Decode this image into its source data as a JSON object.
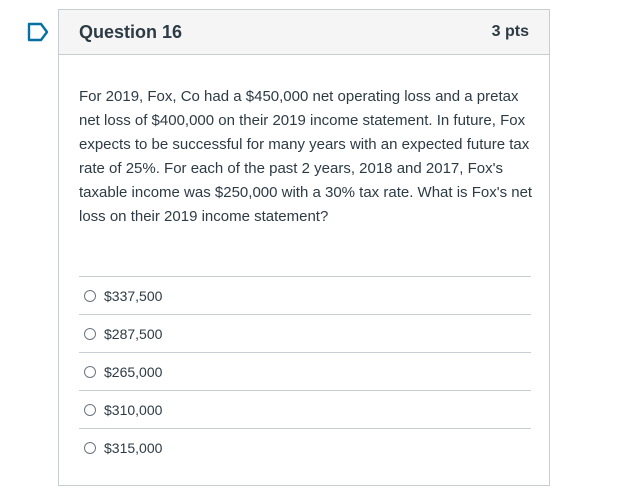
{
  "icons": {
    "flag": "flag-outline-icon",
    "flag_color": "#0770a3",
    "radio": "radio-unselected-icon"
  },
  "question": {
    "title": "Question 16",
    "points": "3 pts",
    "text": "For 2019, Fox, Co had a $450,000 net operating loss and a pretax net loss of $400,000 on their 2019 income statement. In future, Fox expects to be successful for many years with an expected future tax rate of 25%. For each of the past 2 years, 2018 and 2017, Fox's taxable income was $250,000 with a 30% tax rate. What is Fox's net loss on their 2019 income statement?",
    "answers": [
      {
        "label": "$337,500"
      },
      {
        "label": "$287,500"
      },
      {
        "label": "$265,000"
      },
      {
        "label": "$310,000"
      },
      {
        "label": "$315,000"
      }
    ]
  }
}
